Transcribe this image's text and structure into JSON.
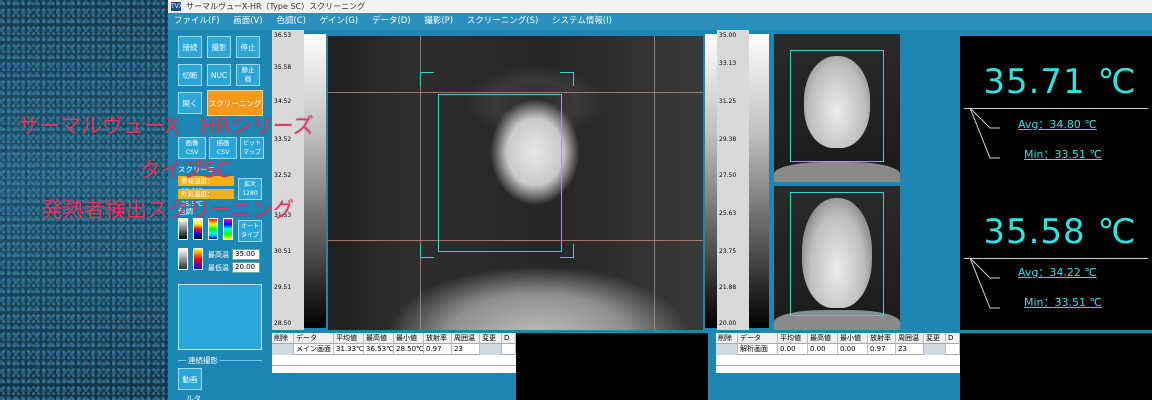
{
  "window": {
    "title": "サーマルヴューX-HR（Type SC）スクリーニング",
    "app_icon": "TVX"
  },
  "menu": [
    "ファイル(F)",
    "画面(V)",
    "色調(C)",
    "ゲイン(G)",
    "データ(D)",
    "撮影(P)",
    "スクリーニング(S)",
    "システム情報(I)"
  ],
  "controls": {
    "connect": "接続",
    "capture": "撮影",
    "stop": "停止",
    "disconnect": "切断",
    "nuc": "NUC",
    "still": "静止画",
    "open": "開く",
    "screening": "スクリーニング",
    "image_csv": "画像CSV",
    "draw_csv": "描画CSV",
    "bitmap": "ビットマップ",
    "enlarge": "拡大1280",
    "screening_label": "スクリーニ",
    "color_label": "色調",
    "alarm_temp": "警報温度：37.5℃",
    "outside_temp": "外気温度：35.5℃",
    "auto_type": "オートタイプ",
    "max_temp_label": "最高温",
    "max_temp_value": "35.00",
    "min_temp_label": "最低温",
    "min_temp_value": "20.00",
    "continuous_label": "連続撮影",
    "video": "動画",
    "partial_label": "ルタ"
  },
  "main_scale": {
    "ticks": [
      "36.53",
      "35.58",
      "34.52",
      "33.52",
      "32.52",
      "31.53",
      "30.51",
      "29.51",
      "28.50"
    ]
  },
  "face_scale": {
    "ticks": [
      "35.00",
      "33.13",
      "31.25",
      "29.38",
      "27.50",
      "25.63",
      "23.75",
      "21.88",
      "20.00"
    ]
  },
  "readouts": [
    {
      "max": "35.71 ℃",
      "avg": "Avg：34.80 ℃",
      "min": "Min：33.51 ℃"
    },
    {
      "max": "35.58 ℃",
      "avg": "Avg：34.22 ℃",
      "min": "Min：33.51 ℃"
    }
  ],
  "table_headers": [
    "削除",
    "データ",
    "平均値",
    "最高値",
    "最小値",
    "放射率",
    "周囲温",
    "変更",
    "D"
  ],
  "table_main": {
    "name": "メイン画面",
    "avg": "31.33℃",
    "max": "36.53℃",
    "min": "28.50℃",
    "emissivity": "0.97",
    "ambient": "23"
  },
  "table_analysis": {
    "name": "解析画面",
    "avg": "0.00",
    "max": "0.00",
    "min": "0.00",
    "emissivity": "0.97",
    "ambient": "23"
  },
  "overlay": {
    "line1": "サーマルヴューX　HRシリーズ",
    "line2": "タイプSC",
    "line3": "発熱者検出スクリーニング"
  },
  "colors": {
    "accent_cyan": "#2ee3e0",
    "overlay_pink": "#e2345e",
    "window_blue": "#1e86b5",
    "orange": "#f39a1d"
  }
}
